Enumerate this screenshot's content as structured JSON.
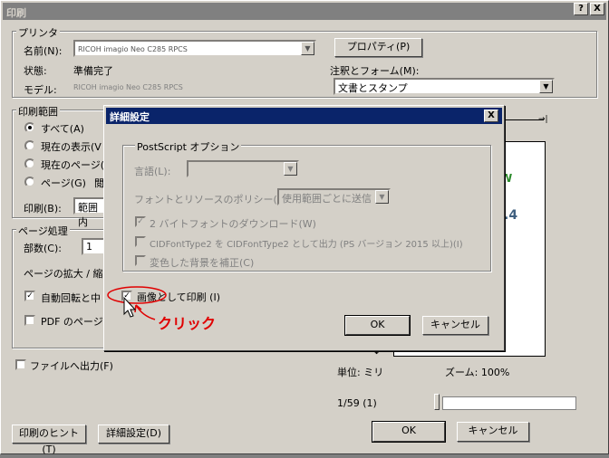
{
  "window": {
    "title": "印刷",
    "help_label": "?",
    "close_label": "X"
  },
  "printer": {
    "group_label": "プリンタ",
    "name_label": "名前(N):",
    "name_value": "RICOH imagio Neo C285 RPCS",
    "properties_button": "プロパティ(P)",
    "status_label": "状態:",
    "status_value": "準備完了",
    "model_label": "モデル:",
    "model_value": "RICOH imagio Neo C285 RPCS",
    "annot_label": "注釈とフォーム(M):",
    "annot_value": "文書とスタンプ"
  },
  "range": {
    "group_label": "印刷範囲",
    "all": "すべて(A)",
    "current_view": "現在の表示(V",
    "current_page": "現在のページ(",
    "pages": "ページ(G)",
    "pages_suffix": "閲",
    "print_label": "印刷(B):",
    "print_value": "範囲内"
  },
  "handling": {
    "group_label": "ページ処理",
    "copies_label": "部数(C):",
    "copies_value": "1",
    "scaling_label": "ページの拡大 / 縮",
    "autorotate_label": "自動回転と中",
    "pdf_label": "PDF のページサ"
  },
  "print_to_file": "ファイルへ出力(F)",
  "preview": {
    "unit": "単位: ミリ",
    "zoom": "ズーム: 100%",
    "page": "1/59 (1)",
    "arrow": "↕"
  },
  "footer": {
    "hint_button": "印刷のヒント(T)",
    "advanced_button": "詳細設定(D)",
    "ok": "OK",
    "cancel": "キャンセル"
  },
  "dialog": {
    "title": "詳細設定",
    "close": "X",
    "ps_group": "PostScript オプション",
    "language_label": "言語(L):",
    "font_policy_label": "フォントとリソースのポリシー(F):",
    "font_policy_value": "使用範囲ごとに送信",
    "option1": "2 バイトフォントのダウンロード(W)",
    "option2": "CIDFontType2 を CIDFontType2 として出力 (PS バージョン 2015 以上)(I)",
    "option3": "変色した背景を補正(C)",
    "print_as_image": "画像として印刷 (I)",
    "ok": "OK",
    "cancel": "キャンセル"
  },
  "annotation": {
    "text": "クリック",
    "color": "#e00000"
  }
}
